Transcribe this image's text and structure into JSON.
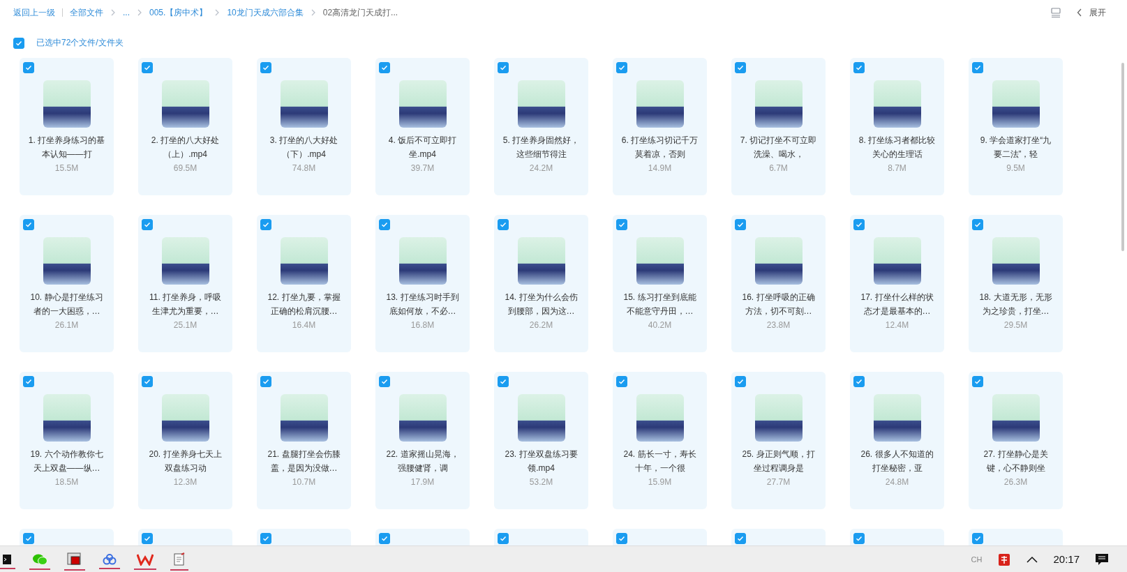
{
  "breadcrumb": {
    "back": "返回上一级",
    "items": [
      {
        "label": "全部文件",
        "current": false
      },
      {
        "label": "...",
        "current": false
      },
      {
        "label": "005.【房中术】",
        "current": false
      },
      {
        "label": "10龙门天成六部合集",
        "current": false
      },
      {
        "label": "02高清龙门天成打...",
        "current": true
      }
    ]
  },
  "toolbar": {
    "expand_label": "展开"
  },
  "select_all": {
    "checked": true,
    "label": "已选中72个文件/文件夹"
  },
  "files": [
    {
      "name": "1. 打坐养身练习的基本认知——打",
      "size": "15.5M",
      "selected": true
    },
    {
      "name": "2. 打坐的八大好处（上）.mp4",
      "size": "69.5M",
      "selected": true
    },
    {
      "name": "3. 打坐的八大好处（下）.mp4",
      "size": "74.8M",
      "selected": true
    },
    {
      "name": "4. 饭后不可立即打坐.mp4",
      "size": "39.7M",
      "selected": true
    },
    {
      "name": "5. 打坐养身固然好，这些细节得注",
      "size": "24.2M",
      "selected": true
    },
    {
      "name": "6. 打坐练习切记千万莫着凉，否则",
      "size": "14.9M",
      "selected": true
    },
    {
      "name": "7. 切记打坐不可立即洗澡、喝水，",
      "size": "6.7M",
      "selected": true
    },
    {
      "name": "8. 打坐练习者都比较关心的生理话",
      "size": "8.7M",
      "selected": true
    },
    {
      "name": "9. 学会道家打坐“九要二法”，轻",
      "size": "9.5M",
      "selected": true
    },
    {
      "name": "10. 静心是打坐练习者的一大困惑，…",
      "size": "26.1M",
      "selected": true
    },
    {
      "name": "11. 打坐养身，呼吸生津尤为重要，…",
      "size": "25.1M",
      "selected": true
    },
    {
      "name": "12. 打坐九要，掌握正确的松肩沉腰…",
      "size": "16.4M",
      "selected": true
    },
    {
      "name": "13. 打坐练习时手到底如何放，不必…",
      "size": "16.8M",
      "selected": true
    },
    {
      "name": "14. 打坐为什么会伤到腰部，因为这…",
      "size": "26.2M",
      "selected": true
    },
    {
      "name": "15. 练习打坐到底能不能意守丹田，…",
      "size": "40.2M",
      "selected": true
    },
    {
      "name": "16. 打坐呼吸的正确方法，切不可刻…",
      "size": "23.8M",
      "selected": true
    },
    {
      "name": "17. 打坐什么样的状态才是最基本的…",
      "size": "12.4M",
      "selected": true
    },
    {
      "name": "18. 大道无形，无形为之珍贵，打坐…",
      "size": "29.5M",
      "selected": true
    },
    {
      "name": "19. 六个动作教你七天上双盘——纵…",
      "size": "18.5M",
      "selected": true
    },
    {
      "name": "20. 打坐养身七天上双盘练习动",
      "size": "12.3M",
      "selected": true
    },
    {
      "name": "21. 盘腿打坐会伤膝盖，是因为没做…",
      "size": "10.7M",
      "selected": true
    },
    {
      "name": "22. 道家摇山晃海，强腰健肾，调",
      "size": "17.9M",
      "selected": true
    },
    {
      "name": "23. 打坐双盘练习要领.mp4",
      "size": "53.2M",
      "selected": true
    },
    {
      "name": "24. 筋长一寸，寿长十年，一个很",
      "size": "15.9M",
      "selected": true
    },
    {
      "name": "25. 身正则气顺，打坐过程调身是",
      "size": "27.7M",
      "selected": true
    },
    {
      "name": "26. 很多人不知道的打坐秘密，亚",
      "size": "24.8M",
      "selected": true
    },
    {
      "name": "27. 打坐静心是关键，心不静则坐",
      "size": "26.3M",
      "selected": true
    },
    {
      "selected": true
    },
    {
      "selected": true
    },
    {
      "selected": true
    },
    {
      "selected": true
    },
    {
      "selected": true
    },
    {
      "selected": true
    },
    {
      "selected": true
    },
    {
      "selected": true
    },
    {
      "selected": true
    }
  ],
  "taskbar": {
    "time": "20:17",
    "ime": "CH"
  }
}
